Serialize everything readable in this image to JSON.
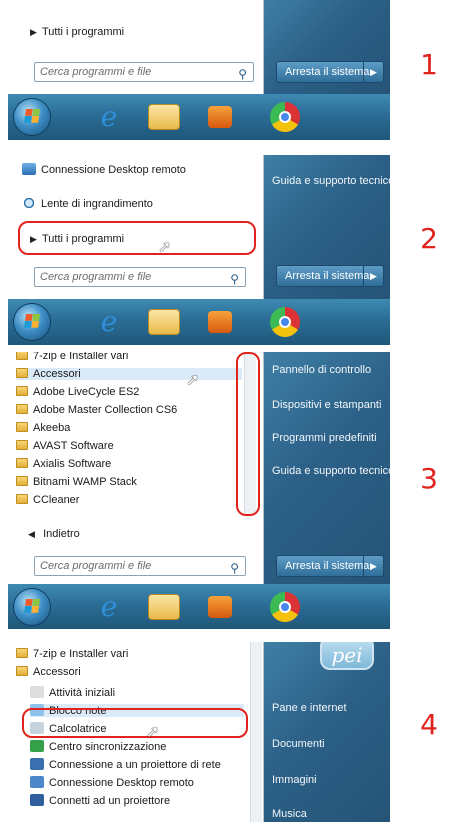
{
  "steps": [
    "1",
    "2",
    "3",
    "4"
  ],
  "panel1": {
    "all_programs": "Tutti i programmi",
    "search_placeholder": "Cerca programmi e file",
    "shutdown": "Arresta il sistema"
  },
  "panel2": {
    "items": [
      "Connessione Desktop remoto",
      "Lente di ingrandimento"
    ],
    "all_programs": "Tutti i programmi",
    "search_placeholder": "Cerca programmi e file",
    "shutdown": "Arresta il sistema",
    "right_items": [
      "Guida e supporto tecnico"
    ]
  },
  "panel3": {
    "programs": [
      "7-zip e Installer vari",
      "Accessori",
      "Adobe LiveCycle ES2",
      "Adobe Master Collection CS6",
      "Akeeba",
      "AVAST Software",
      "Axialis Software",
      "Bitnami WAMP Stack",
      "CCleaner"
    ],
    "back": "Indietro",
    "search_placeholder": "Cerca programmi e file",
    "shutdown": "Arresta il sistema",
    "right_items": [
      "Pannello di controllo",
      "Dispositivi e stampanti",
      "Programmi predefiniti",
      "Guida e supporto tecnico"
    ]
  },
  "panel4": {
    "folders": [
      "7-zip e Installer vari",
      "Accessori"
    ],
    "subitems": [
      "Attività iniziali",
      "Blocco note",
      "Calcolatrice",
      "Centro sincronizzazione",
      "Connessione a un proiettore di rete",
      "Connessione Desktop remoto",
      "Connetti ad un proiettore"
    ],
    "logo": "pei",
    "right_items": [
      "Pane e internet",
      "Documenti",
      "Immagini",
      "Musica"
    ]
  },
  "taskbar_icons": [
    "start-orb-icon",
    "internet-explorer-icon",
    "file-explorer-icon",
    "media-player-icon",
    "chrome-icon"
  ]
}
